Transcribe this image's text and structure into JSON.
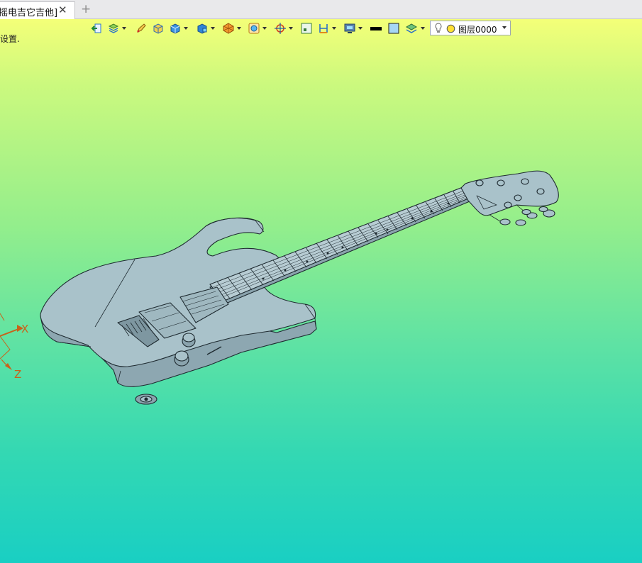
{
  "tab": {
    "title": "摇电吉它吉他]",
    "close_glyph": "✕",
    "new_tab_glyph": "+"
  },
  "viewport": {
    "hint_text": "设置.",
    "background_top": "#f4ff78",
    "background_bottom": "#19cfc3"
  },
  "toolbar": {
    "layer_select": {
      "value": "图层0000"
    }
  },
  "axes": {
    "x_label": "X",
    "z_label": "Z",
    "color": "#c8621a"
  },
  "model": {
    "name": "electric-guitar",
    "body_color": "#a9c2ca",
    "edge_color": "#1e2a30"
  }
}
